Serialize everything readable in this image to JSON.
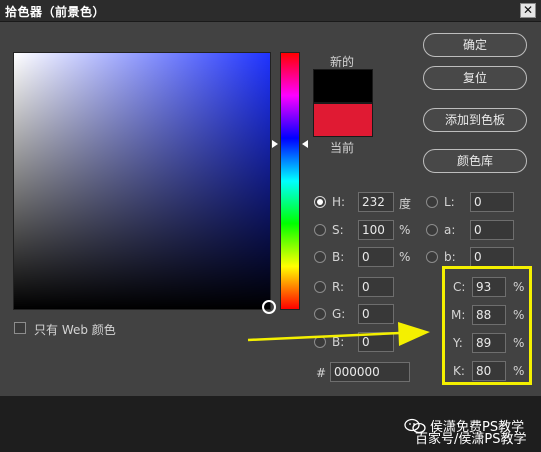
{
  "dialog": {
    "title": "拾色器（前景色）",
    "close_label": "✕"
  },
  "swatch": {
    "new_label": "新的",
    "current_label": "当前",
    "new_color": "#000000",
    "current_color": "#E01A33"
  },
  "buttons": {
    "ok": "确定",
    "reset": "复位",
    "add_to_swatches": "添加到色板",
    "color_libraries": "颜色库"
  },
  "hsb": {
    "h": {
      "label": "H:",
      "value": "232",
      "unit": "度",
      "selected": true
    },
    "s": {
      "label": "S:",
      "value": "100",
      "unit": "%"
    },
    "b": {
      "label": "B:",
      "value": "0",
      "unit": "%"
    }
  },
  "lab": {
    "l": {
      "label": "L:",
      "value": "0"
    },
    "a": {
      "label": "a:",
      "value": "0"
    },
    "b": {
      "label": "b:",
      "value": "0"
    }
  },
  "rgb": {
    "r": {
      "label": "R:",
      "value": "0"
    },
    "g": {
      "label": "G:",
      "value": "0"
    },
    "b": {
      "label": "B:",
      "value": "0"
    }
  },
  "cmyk": {
    "c": {
      "label": "C:",
      "value": "93",
      "unit": "%"
    },
    "m": {
      "label": "M:",
      "value": "88",
      "unit": "%"
    },
    "y": {
      "label": "Y:",
      "value": "89",
      "unit": "%"
    },
    "k": {
      "label": "K:",
      "value": "80",
      "unit": "%"
    }
  },
  "hex": {
    "label": "#",
    "value": "000000"
  },
  "web_only": {
    "label": "只有 Web 颜色"
  },
  "annotation_color": "#F4F000",
  "watermark": {
    "line1": "侯潇免费PS教学",
    "line2": "百家号/侯潇PS教学"
  }
}
